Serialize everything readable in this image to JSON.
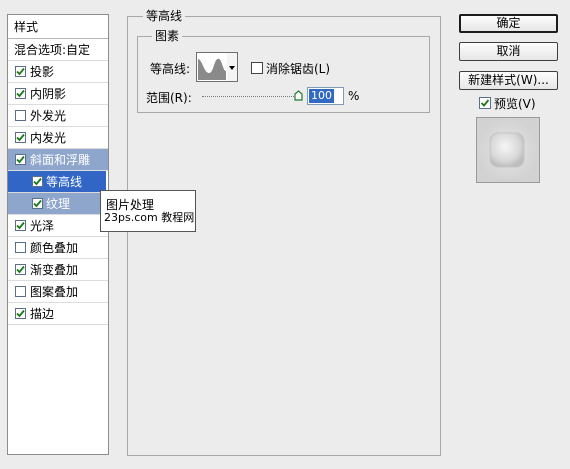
{
  "left_panel": {
    "header": "样式",
    "blend_label": "混合选项:自定",
    "items": [
      {
        "label": "投影",
        "checked": true
      },
      {
        "label": "内阴影",
        "checked": true
      },
      {
        "label": "外发光",
        "checked": false
      },
      {
        "label": "内发光",
        "checked": true
      },
      {
        "label": "斜面和浮雕",
        "checked": true,
        "selected": true
      },
      {
        "label": "等高线",
        "checked": true,
        "sub": true,
        "active": true
      },
      {
        "label": "纹理",
        "checked": true,
        "sub": true
      },
      {
        "label": "光泽",
        "checked": true
      },
      {
        "label": "颜色叠加",
        "checked": false
      },
      {
        "label": "渐变叠加",
        "checked": true
      },
      {
        "label": "图案叠加",
        "checked": false
      },
      {
        "label": "描边",
        "checked": true
      }
    ]
  },
  "main": {
    "group_title": "等高线",
    "subgroup_title": "图素",
    "contour_label": "等高线:",
    "antialias_label": "消除锯齿(L)",
    "antialias_checked": false,
    "range_label": "范围(R):",
    "range_value": "100",
    "range_unit": "%",
    "range_fraction": 1.0
  },
  "buttons": {
    "ok": "确定",
    "cancel": "取消",
    "new_style": "新建样式(W)...",
    "preview_label": "预览(V)",
    "preview_checked": true
  },
  "watermark": {
    "line1": "图片处理",
    "line2": "23ps.com 教程网"
  },
  "colors": {
    "selected_light": "#8fa6cc",
    "selected_dark": "#3166c6",
    "check": "#1a7a1a"
  }
}
